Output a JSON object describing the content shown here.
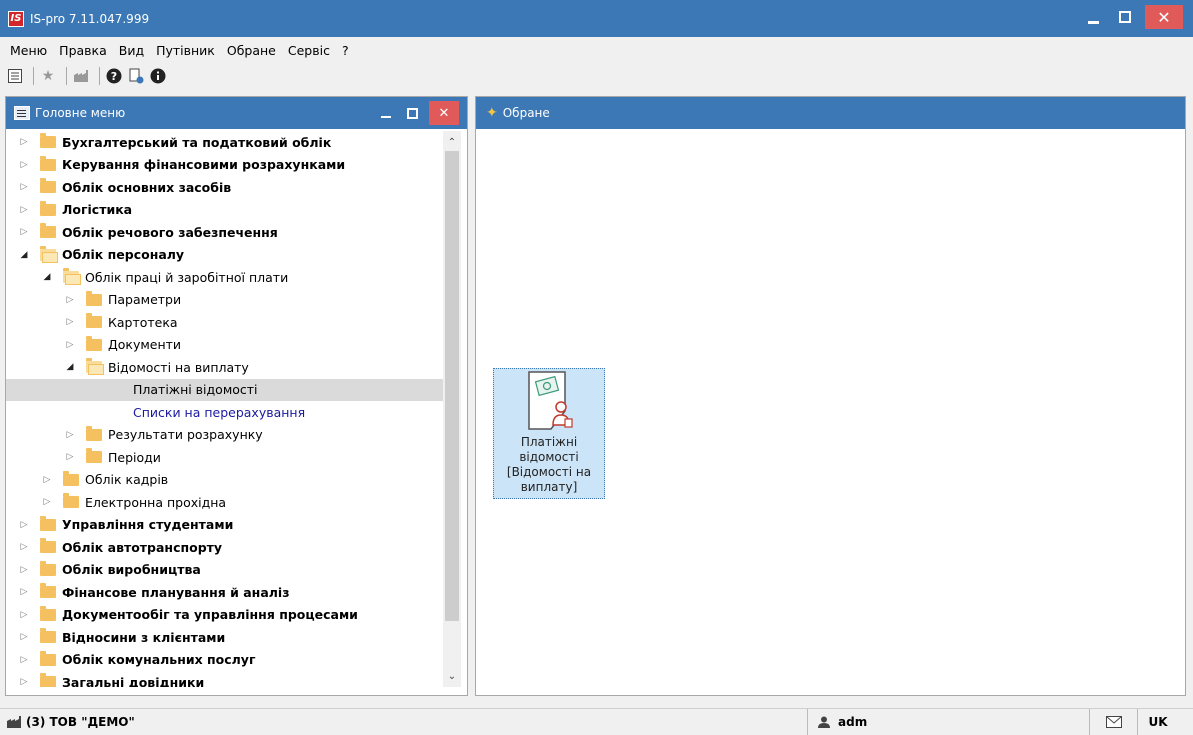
{
  "window": {
    "title": "IS-pro 7.11.047.999",
    "logo_text": "IS"
  },
  "menu": [
    "Меню",
    "Правка",
    "Вид",
    "Путівник",
    "Обране",
    "Сервіс",
    "?"
  ],
  "left_panel": {
    "title": "Головне меню"
  },
  "right_panel": {
    "title": "Обране"
  },
  "tree": [
    {
      "level": 0,
      "label": "Бухгалтерський та податковий облік",
      "bold": true,
      "expanded": false,
      "folder": true
    },
    {
      "level": 0,
      "label": "Керування фінансовими розрахунками",
      "bold": true,
      "expanded": false,
      "folder": true
    },
    {
      "level": 0,
      "label": "Облік основних засобів",
      "bold": true,
      "expanded": false,
      "folder": true
    },
    {
      "level": 0,
      "label": "Логістика",
      "bold": true,
      "expanded": false,
      "folder": true
    },
    {
      "level": 0,
      "label": "Облік речового забезпечення",
      "bold": true,
      "expanded": false,
      "folder": true
    },
    {
      "level": 0,
      "label": "Облік персоналу",
      "bold": true,
      "expanded": true,
      "folder": true
    },
    {
      "level": 1,
      "label": "Облік праці й заробітної плати",
      "bold": false,
      "expanded": true,
      "folder": true
    },
    {
      "level": 2,
      "label": "Параметри",
      "bold": false,
      "expanded": false,
      "folder": true
    },
    {
      "level": 2,
      "label": "Картотека",
      "bold": false,
      "expanded": false,
      "folder": true
    },
    {
      "level": 2,
      "label": "Документи",
      "bold": false,
      "expanded": false,
      "folder": true
    },
    {
      "level": 2,
      "label": "Відомості на виплату",
      "bold": false,
      "expanded": true,
      "folder": true
    },
    {
      "level": 3,
      "label": "Платіжні відомості",
      "bold": false,
      "folder": false,
      "selected": true
    },
    {
      "level": 3,
      "label": "Списки на перерахування",
      "bold": false,
      "folder": false,
      "link": true
    },
    {
      "level": 2,
      "label": "Результати розрахунку",
      "bold": false,
      "expanded": false,
      "folder": true
    },
    {
      "level": 2,
      "label": "Періоди",
      "bold": false,
      "expanded": false,
      "folder": true
    },
    {
      "level": 1,
      "label": "Облік кадрів",
      "bold": false,
      "expanded": false,
      "folder": true
    },
    {
      "level": 1,
      "label": "Електронна прохідна",
      "bold": false,
      "expanded": false,
      "folder": true
    },
    {
      "level": 0,
      "label": "Управління студентами",
      "bold": true,
      "expanded": false,
      "folder": true
    },
    {
      "level": 0,
      "label": "Облік автотранспорту",
      "bold": true,
      "expanded": false,
      "folder": true
    },
    {
      "level": 0,
      "label": "Облік виробництва",
      "bold": true,
      "expanded": false,
      "folder": true
    },
    {
      "level": 0,
      "label": "Фінансове планування й аналіз",
      "bold": true,
      "expanded": false,
      "folder": true
    },
    {
      "level": 0,
      "label": "Документообіг та управління процесами",
      "bold": true,
      "expanded": false,
      "folder": true
    },
    {
      "level": 0,
      "label": "Відносини з клієнтами",
      "bold": true,
      "expanded": false,
      "folder": true
    },
    {
      "level": 0,
      "label": "Облік комунальних послуг",
      "bold": true,
      "expanded": false,
      "folder": true
    },
    {
      "level": 0,
      "label": "Загальні довідники",
      "bold": true,
      "expanded": false,
      "folder": true
    }
  ],
  "favorite_tile": {
    "line1": "Платіжні",
    "line2": "відомості",
    "line3": "[Відомості на",
    "line4": "виплату]"
  },
  "status": {
    "company": "(3) ТОВ \"ДЕМО\"",
    "user": "adm",
    "lang": "UK"
  },
  "colors": {
    "accent": "#3b78b5",
    "close": "#e05a5a",
    "selected_row": "#dadada",
    "link": "#1a1aa0"
  }
}
